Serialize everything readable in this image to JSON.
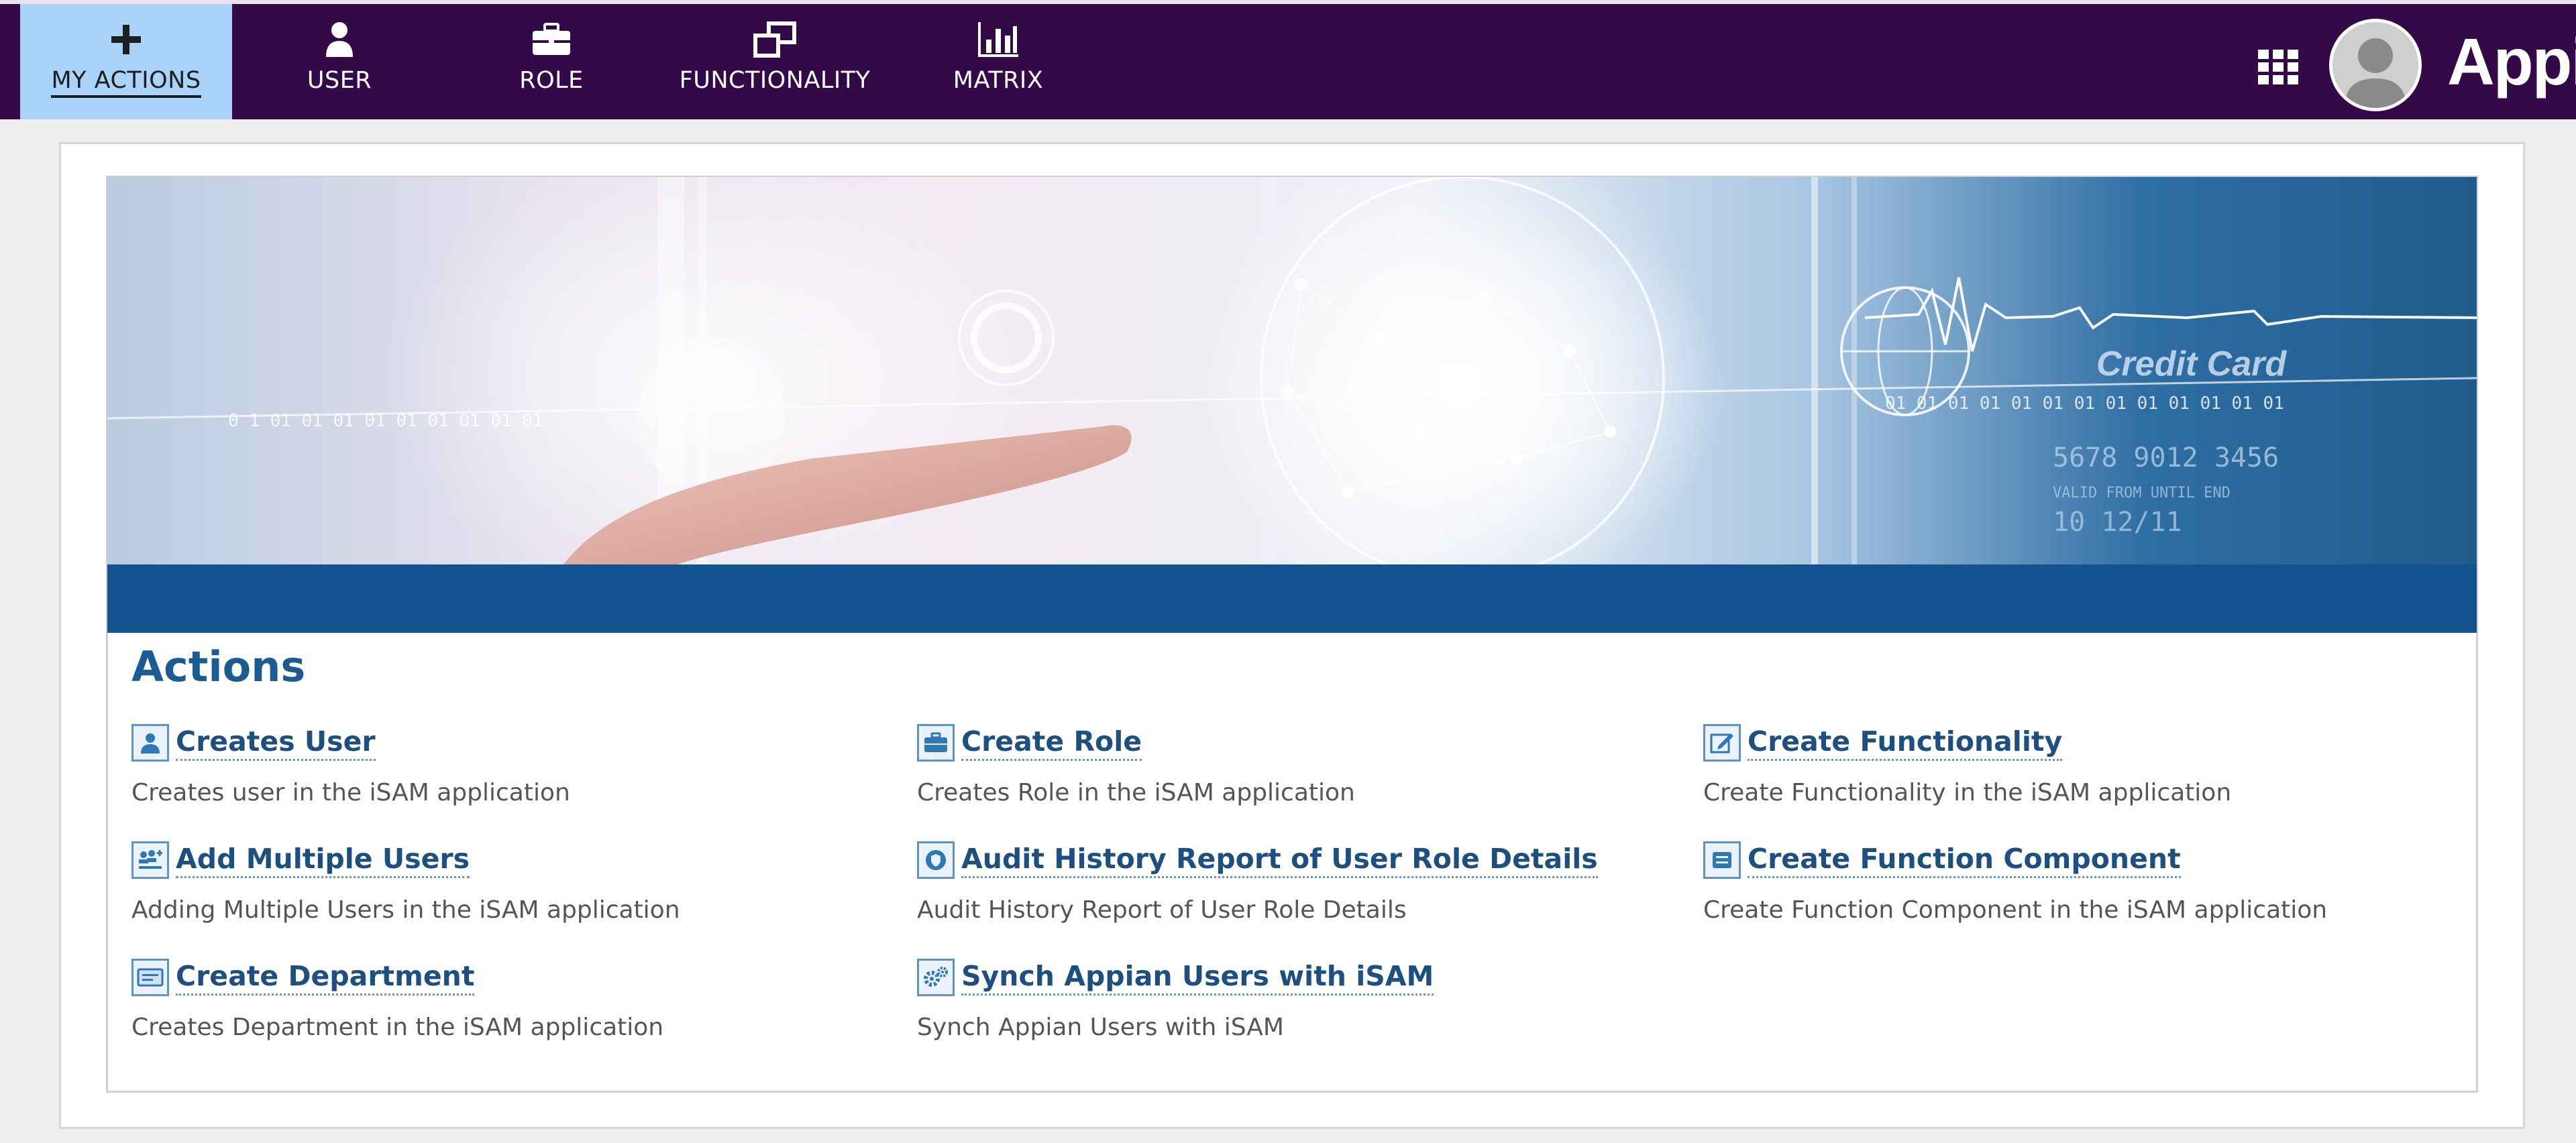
{
  "nav": {
    "tabs": [
      {
        "label": "MY ACTIONS",
        "icon": "plus-icon",
        "active": true
      },
      {
        "label": "USER",
        "icon": "user-icon"
      },
      {
        "label": "ROLE",
        "icon": "briefcase-icon"
      },
      {
        "label": "FUNCTIONALITY",
        "icon": "windows-icon"
      },
      {
        "label": "MATRIX",
        "icon": "bar-chart-icon"
      }
    ],
    "apps_icon": "grid-icon",
    "avatar_icon": "user-avatar",
    "brand": "Appian"
  },
  "banner": {
    "texts": {
      "binary_left": "0 1 01 01 01 01 01 01 01 01 01",
      "binary_right": "01 01 01 01 01 01 01 01 01 01 01 01 01",
      "card_label": "Credit Card",
      "card_number": "5678  9012  3456",
      "card_valid": "VALID FROM  UNTIL END",
      "card_dates": "10    12/11"
    }
  },
  "colors": {
    "nav_bg": "#330a47",
    "nav_active": "#a9d3fb",
    "band": "#155390",
    "heading": "#1d5b93",
    "link": "#1d4f80"
  },
  "actions": {
    "heading": "Actions",
    "items": [
      {
        "title": "Creates User",
        "desc": "Creates user in the iSAM application",
        "icon": "user-icon"
      },
      {
        "title": "Create Role",
        "desc": "Creates Role in the iSAM application",
        "icon": "briefcase-icon"
      },
      {
        "title": "Create Functionality",
        "desc": "Create Functionality in the iSAM application",
        "icon": "edit-icon"
      },
      {
        "title": "Add Multiple Users",
        "desc": "Adding Multiple Users in the iSAM application",
        "icon": "users-icon"
      },
      {
        "title": "Audit History Report of User Role Details",
        "desc": "Audit History Report of User Role Details",
        "icon": "shield-icon"
      },
      {
        "title": "Create Function Component",
        "desc": "Create Function Component in the iSAM application",
        "icon": "list-icon"
      },
      {
        "title": "Create Department",
        "desc": "Creates Department in the iSAM application",
        "icon": "card-icon"
      },
      {
        "title": "Synch Appian Users with iSAM",
        "desc": "Synch Appian Users with iSAM",
        "icon": "gears-icon"
      }
    ]
  }
}
